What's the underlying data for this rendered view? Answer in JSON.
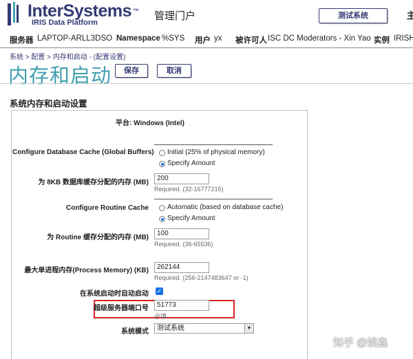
{
  "header": {
    "brand_name": "InterSystems",
    "brand_sub": "IRIS Data Platform",
    "portal_title": "管理门户",
    "test_system_button": "测试系统",
    "edge_char": "主"
  },
  "info_bar": {
    "server_label": "服务器",
    "server_value": "LAPTOP-ARLL3DSO",
    "namespace_label": "Namespace",
    "namespace_value": "%SYS",
    "user_label": "用户",
    "user_value": "yx",
    "licensee_label": "被许可人",
    "licensee_value": "ISC DC Moderators - Xin Yao",
    "instance_label": "实例",
    "instance_value": "IRISH"
  },
  "breadcrumb": "系统 > 配置 > 内存和启动 - (配置设置)",
  "page_title": "内存和启动",
  "actions": {
    "save": "保存",
    "cancel": "取消"
  },
  "section_title": "系统内存和启动设置",
  "form": {
    "platform": "平台: Windows (Intel)",
    "db_cache_label": "Configure Database Cache (Global Buffers)",
    "db_cache_options": [
      "Initial (25% of physical memory)",
      "Specify Amount"
    ],
    "db_cache_selected": "Specify Amount",
    "mem8kb_label": "为 8KB 数据库缓存分配的内存 (MB)",
    "mem8kb_value": "200",
    "mem8kb_hint": "Required. (32-16777215)",
    "routine_cache_label": "Configure Routine Cache",
    "routine_cache_options": [
      "Automatic (based on database cache)",
      "Specify Amount"
    ],
    "routine_cache_selected": "Specify Amount",
    "routine_mem_label": "为 Routine 缓存分配的内存 (MB)",
    "routine_mem_value": "100",
    "routine_mem_hint": "Required. (36-65536)",
    "max_proc_mem_label": "最大单进程内存(Process Memory) (KB)",
    "max_proc_mem_value": "262144",
    "max_proc_mem_hint": "Required. (256-2147483647 or -1)",
    "autostart_label": "在系统启动时自动启动",
    "autostart_checked": true,
    "superserver_port_label": "超级服务器端口号",
    "superserver_port_value": "51773",
    "superserver_port_hint": "必填",
    "system_mode_label": "系统模式",
    "system_mode_value": "测试系统"
  },
  "watermark": "知乎 @姚鑫",
  "colors": {
    "brand": "#333b73",
    "title": "#41a0b0",
    "highlight": "#d92222",
    "accent": "#1a73e8"
  }
}
